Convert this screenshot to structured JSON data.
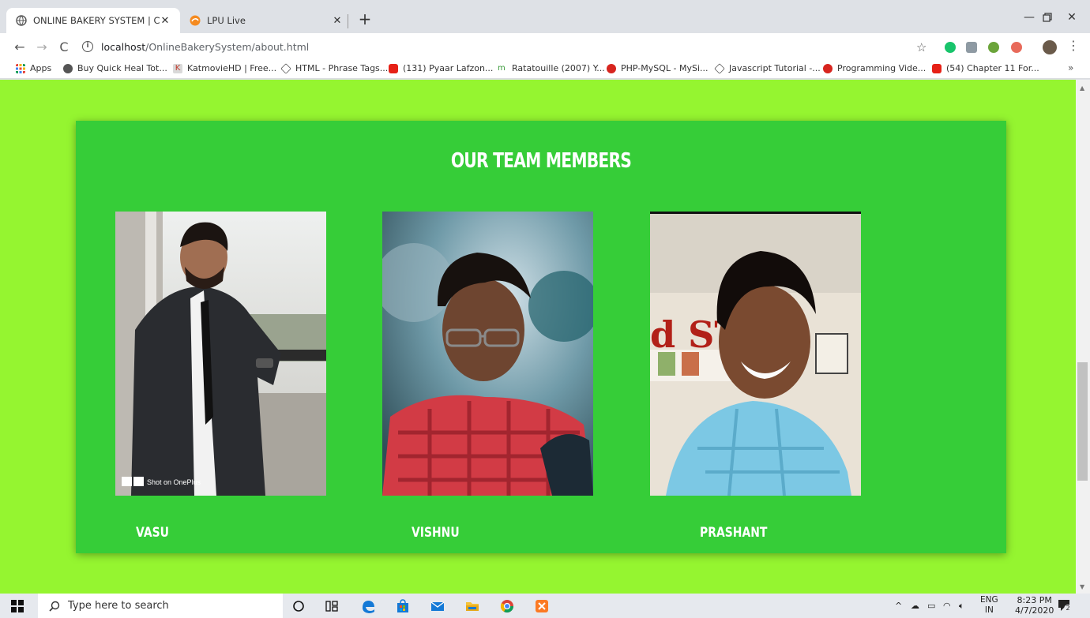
{
  "browser": {
    "tabs": [
      {
        "title": "ONLINE BAKERY SYSTEM | Custo",
        "active": true
      },
      {
        "title": "LPU Live",
        "active": false
      }
    ],
    "url": {
      "host": "localhost",
      "path": "/OnlineBakerySystem/about.html"
    },
    "bookmarks": [
      "Apps",
      "Buy Quick Heal Tot...",
      "KatmovieHD | Free...",
      "HTML - Phrase Tags...",
      "(131) Pyaar Lafzon...",
      "Ratatouille (2007) Y...",
      "PHP-MySQL - MySi...",
      "Javascript Tutorial -...",
      "Programming Vide...",
      "(54) Chapter 11 For..."
    ],
    "bookmarks_more": "»"
  },
  "page": {
    "heading": "OUR TEAM MEMBERS",
    "members": [
      {
        "name": "VASU",
        "watermark": "Shot on OnePlus"
      },
      {
        "name": "VISHNU"
      },
      {
        "name": "PRASHANT"
      }
    ],
    "photo2_text": "d ST"
  },
  "taskbar": {
    "search_placeholder": "Type here to search",
    "lang_line1": "ENG",
    "lang_line2": "IN",
    "time": "8:23 PM",
    "date": "4/7/2020",
    "notification_count": "2"
  },
  "colors": {
    "page_background": "#95f530",
    "card_background": "#36cd38"
  }
}
